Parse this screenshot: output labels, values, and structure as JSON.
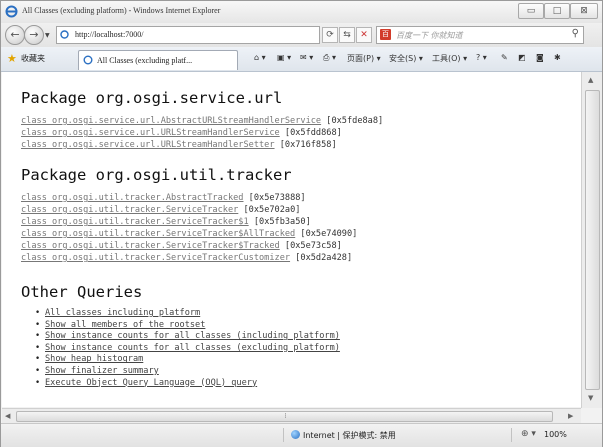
{
  "window": {
    "title": "All Classes (excluding platform) - Windows Internet Explorer",
    "minimize": "▭",
    "maximize": "□",
    "close": "⊠"
  },
  "address": {
    "url": "http://localhost:7000/",
    "search_placeholder": "百度一下 你就知道",
    "back_icon": "←",
    "forward_icon": "→"
  },
  "tabs": {
    "favorites_label": "收藏夹",
    "active_tab": "All Classes (excluding platf...",
    "commands": [
      "页面(P) ▾",
      "安全(S) ▾",
      "工具(O) ▾"
    ]
  },
  "sections": [
    {
      "heading": "Package org.osgi.service.url",
      "classes": [
        {
          "name": "class org.osgi.service.url.AbstractURLStreamHandlerService",
          "addr": "[0x5fde8a8]"
        },
        {
          "name": "class org.osgi.service.url.URLStreamHandlerService",
          "addr": "[0x5fdd868]"
        },
        {
          "name": "class org.osgi.service.url.URLStreamHandlerSetter",
          "addr": "[0x716f858]"
        }
      ]
    },
    {
      "heading": "Package org.osgi.util.tracker",
      "classes": [
        {
          "name": "class org.osgi.util.tracker.AbstractTracked",
          "addr": "[0x5e73888]"
        },
        {
          "name": "class org.osgi.util.tracker.ServiceTracker",
          "addr": "[0x5e702a0]"
        },
        {
          "name": "class org.osgi.util.tracker.ServiceTracker$1",
          "addr": "[0x5fb3a50]"
        },
        {
          "name": "class org.osgi.util.tracker.ServiceTracker$AllTracked",
          "addr": "[0x5e74090]"
        },
        {
          "name": "class org.osgi.util.tracker.ServiceTracker$Tracked",
          "addr": "[0x5e73c58]"
        },
        {
          "name": "class org.osgi.util.tracker.ServiceTrackerCustomizer",
          "addr": "[0x5d2a428]"
        }
      ]
    }
  ],
  "queries": {
    "heading": "Other Queries",
    "items": [
      "All classes including platform",
      "Show all members of the rootset",
      "Show instance counts for all classes (including platform)",
      "Show instance counts for all classes (excluding platform)",
      "Show heap histogram",
      "Show finalizer summary",
      "Execute Object Query Language (OQL) query"
    ]
  },
  "status": {
    "zone": "Internet | 保护模式: 禁用",
    "zoom": "100%"
  },
  "colors": {
    "link": "#777777",
    "ie_blue": "#2a6fc2"
  }
}
